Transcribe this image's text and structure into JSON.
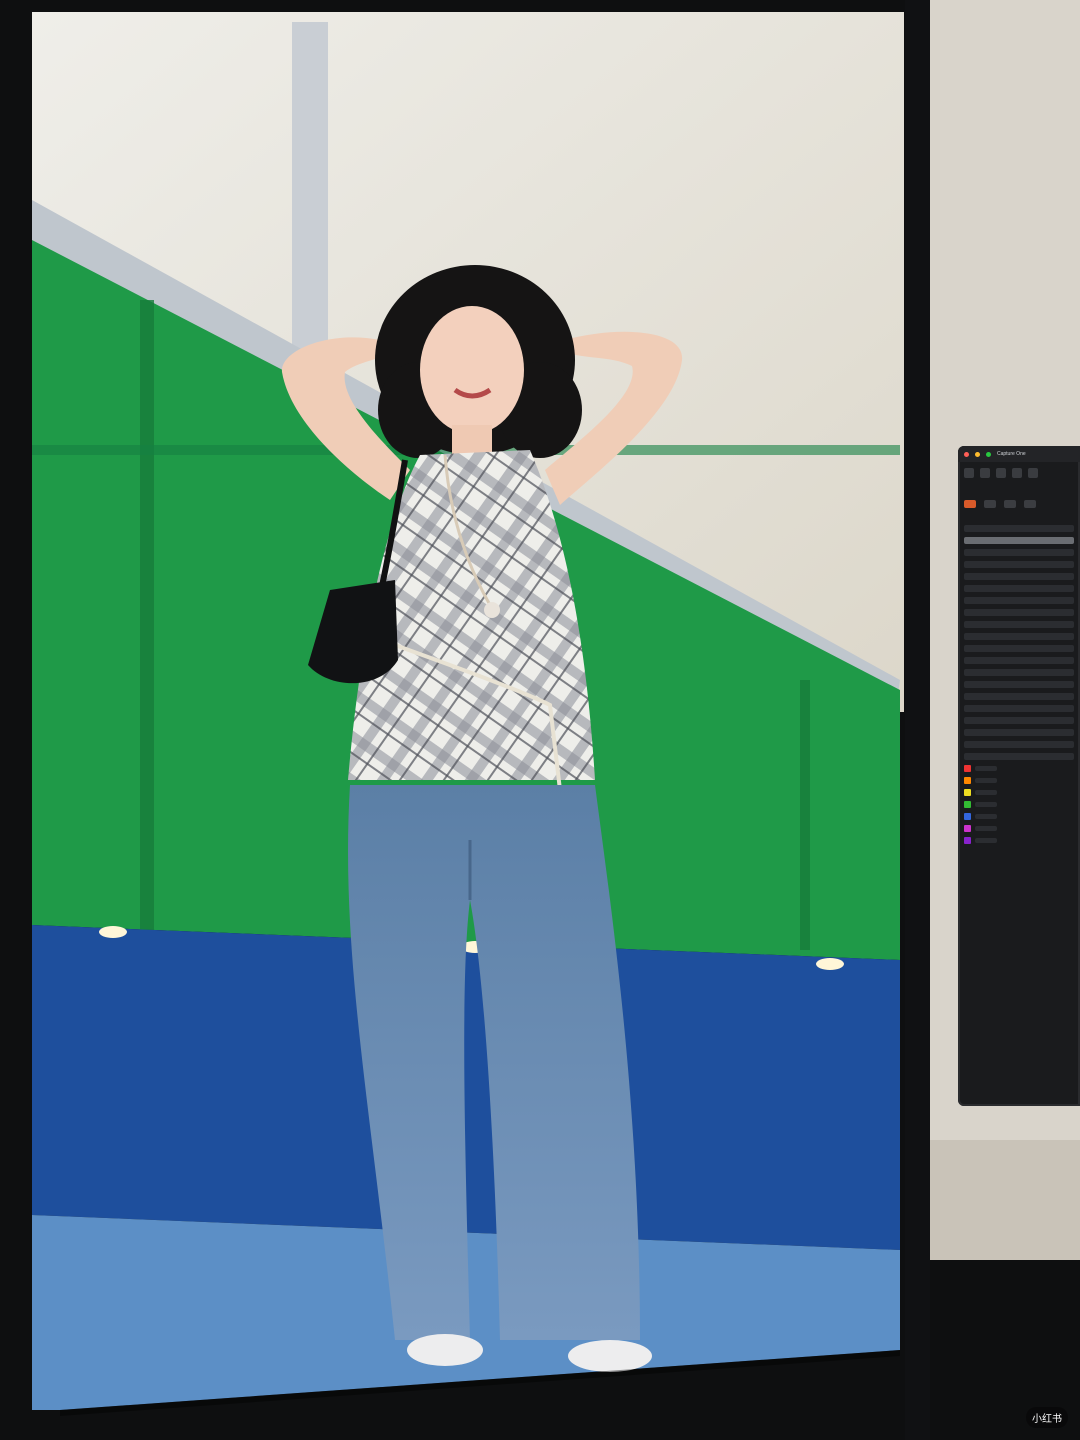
{
  "colors": {
    "green_wall": "#1f9a48",
    "green_shadow": "#12753a",
    "blue_ledge": "#1e4f9d",
    "blue_floor": "#5c8fc6",
    "panel_white": "#ece9e1",
    "frame_black": "#0e0f10",
    "denim": "#6f8fb3",
    "plaid_light": "#efefec",
    "plaid_dark": "#6d6f77",
    "app_accent": "#d85a2a"
  },
  "app": {
    "title": "Capture One"
  },
  "watermark": "小红书"
}
